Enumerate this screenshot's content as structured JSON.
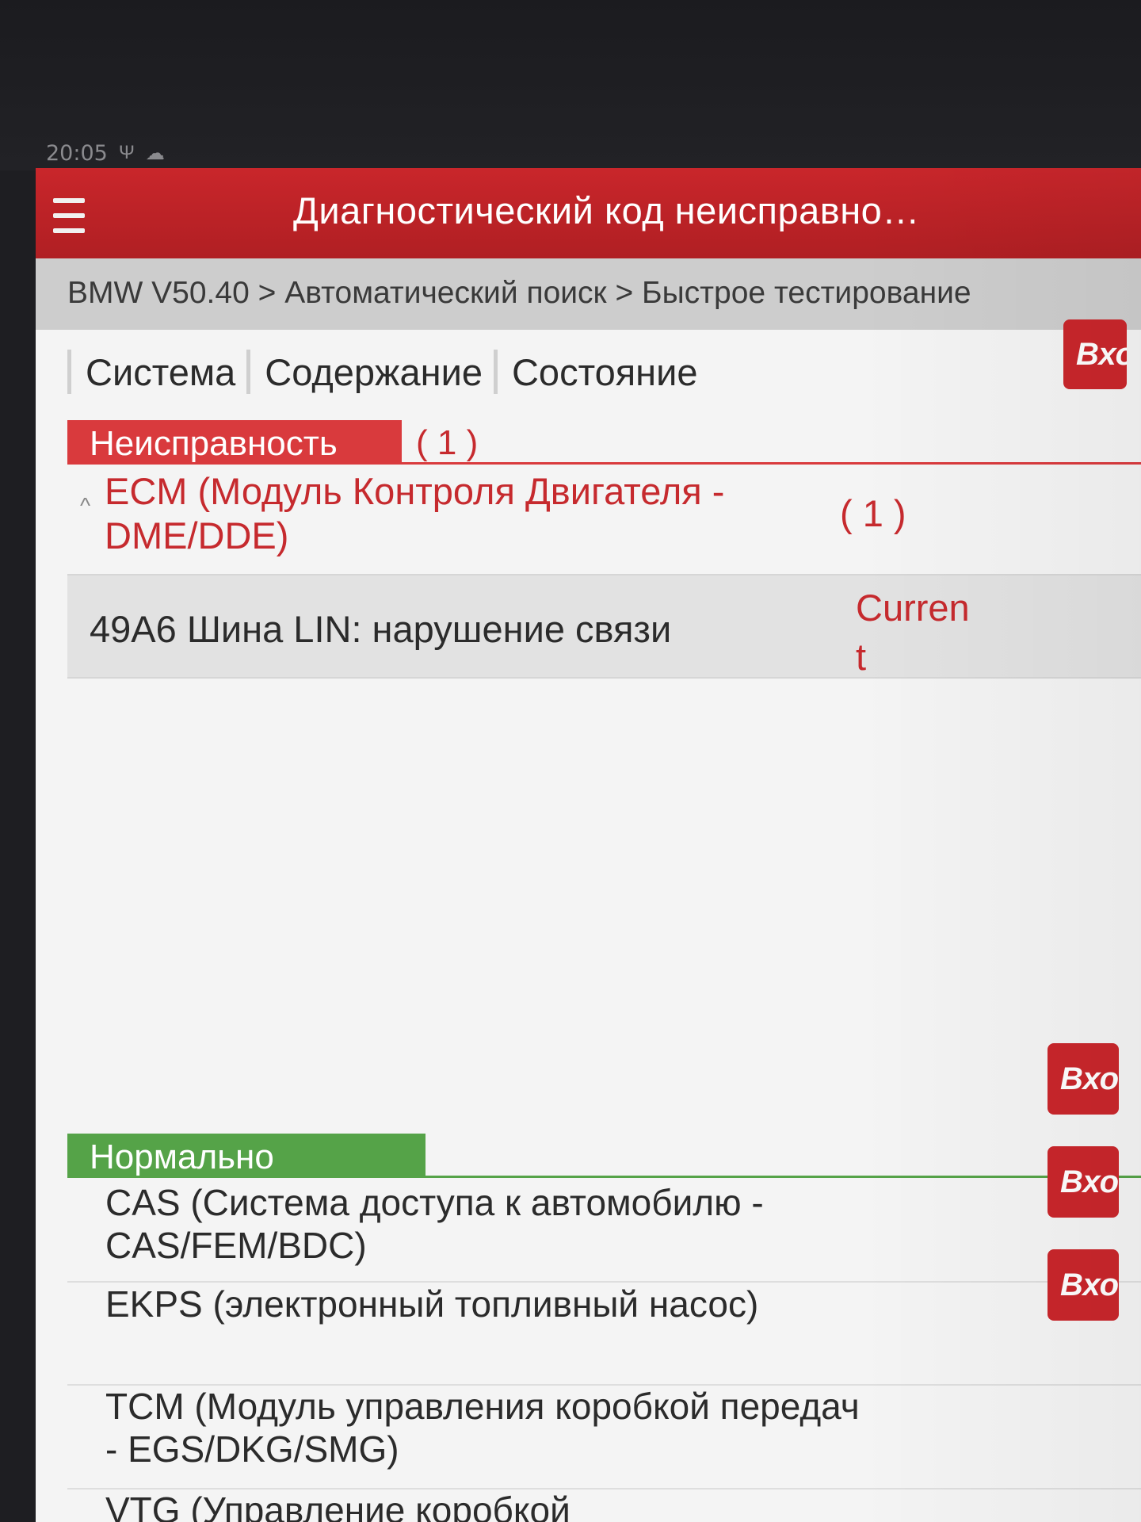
{
  "status_bar": {
    "time": "20:05",
    "icons": [
      "usb-icon",
      "cloud-icon"
    ]
  },
  "header": {
    "title": "Диагностический код неисправно…"
  },
  "breadcrumb": {
    "text": "BMW V50.40 > Автоматический поиск  > Быстрое тестирование"
  },
  "tabs": [
    {
      "label": "Система"
    },
    {
      "label": "Содержание"
    },
    {
      "label": "Состояние"
    }
  ],
  "fault_section": {
    "label": "Неисправность",
    "count": "( 1 )",
    "systems": [
      {
        "name": "ECM (Модуль Контроля Двигателя - DME/DDE)",
        "count": "( 1 )",
        "enter_label": "Вход",
        "codes": [
          {
            "code_text": "49A6 Шина LIN: нарушение связи",
            "status": "Current"
          }
        ]
      }
    ]
  },
  "normal_section": {
    "label": "Нормально",
    "systems": [
      {
        "name": "CAS (Система доступа к автомобилю - CAS/FEM/BDC)",
        "enter_label": "Вход"
      },
      {
        "name": "EKPS (электронный топливный насос)",
        "enter_label": "Вход"
      },
      {
        "name": "TCM (Модуль управления коробкой передач - EGS/DKG/SMG)",
        "enter_label": "Вход"
      },
      {
        "name": "VTG (Управление коробкой"
      }
    ]
  },
  "colors": {
    "brand_red": "#c9262b",
    "fault_red": "#d93a3d",
    "normal_green": "#55a348"
  }
}
